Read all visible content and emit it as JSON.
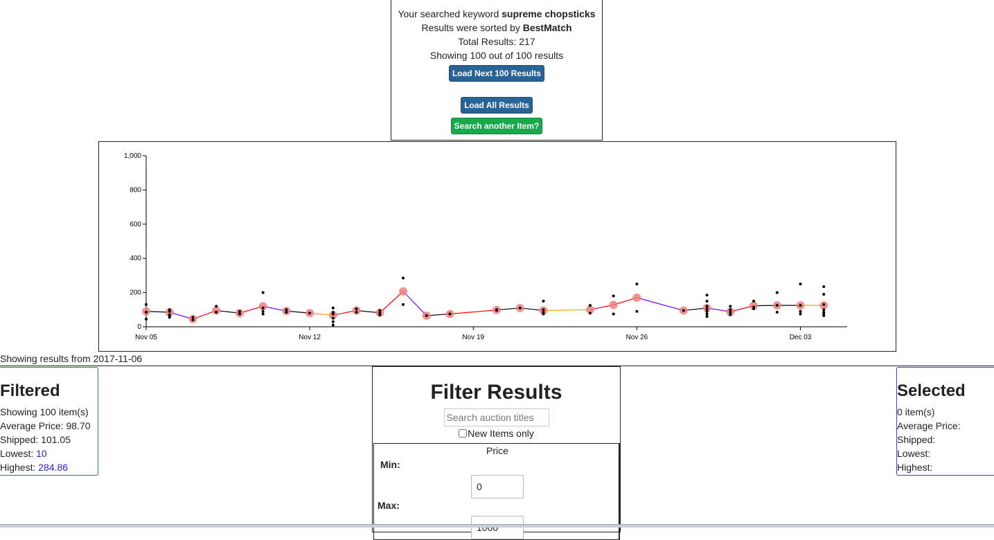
{
  "summary": {
    "keyword_prefix": "Your searched keyword",
    "keyword": "supreme chopsticks",
    "sorted_prefix": "Results were sorted by",
    "sorted_by": "BestMatch",
    "total_results": "Total Results: 217",
    "showing": "Showing 100 out of 100 results",
    "load_next_label": "Load Next 100 Results",
    "load_all_label": "Load All Results",
    "search_another_label": "Search another Item?"
  },
  "colors": {
    "button_blue": "#2a6496",
    "button_green": "#17a94a",
    "trend_up": "#ff0000",
    "trend_down": "#7a00ff",
    "trend_flat": "#ffa500",
    "trend_default": "#000000",
    "average_marker": "#f08080",
    "filtered_border": "#2c8a2c",
    "selected_border": "#5533cc"
  },
  "chart_data": {
    "type": "scatter",
    "title": "",
    "xlabel": "",
    "ylabel": "",
    "x_ticks": [
      "Nov 05",
      "Nov 12",
      "Nov 19",
      "Nov 26",
      "Dec 03"
    ],
    "y_ticks": [
      "0",
      "200",
      "400",
      "600",
      "800",
      "1,000"
    ],
    "ylim": [
      0,
      1000
    ],
    "xlim": [
      "2017-11-05",
      "2017-12-05"
    ],
    "series": [
      {
        "points": [
          [
            "2017-11-05",
            130
          ],
          [
            "2017-11-05",
            45
          ],
          [
            "2017-11-05",
            85
          ],
          [
            "2017-11-06",
            100
          ],
          [
            "2017-11-06",
            90
          ],
          [
            "2017-11-06",
            70
          ],
          [
            "2017-11-06",
            65
          ],
          [
            "2017-11-06",
            55
          ],
          [
            "2017-11-07",
            55
          ],
          [
            "2017-11-07",
            40
          ],
          [
            "2017-11-08",
            120
          ],
          [
            "2017-11-08",
            85
          ],
          [
            "2017-11-09",
            90
          ],
          [
            "2017-11-09",
            75
          ],
          [
            "2017-11-10",
            200
          ],
          [
            "2017-11-10",
            110
          ],
          [
            "2017-11-10",
            90
          ],
          [
            "2017-11-10",
            75
          ],
          [
            "2017-11-11",
            100
          ],
          [
            "2017-11-11",
            85
          ],
          [
            "2017-11-12",
            80
          ],
          [
            "2017-11-13",
            110
          ],
          [
            "2017-11-13",
            85
          ],
          [
            "2017-11-13",
            75
          ],
          [
            "2017-11-13",
            50
          ],
          [
            "2017-11-13",
            30
          ],
          [
            "2017-11-13",
            10
          ],
          [
            "2017-11-14",
            105
          ],
          [
            "2017-11-14",
            85
          ],
          [
            "2017-11-15",
            95
          ],
          [
            "2017-11-15",
            80
          ],
          [
            "2017-11-15",
            70
          ],
          [
            "2017-11-16",
            285
          ],
          [
            "2017-11-16",
            130
          ],
          [
            "2017-11-17",
            65
          ],
          [
            "2017-11-18",
            75
          ],
          [
            "2017-11-20",
            100
          ],
          [
            "2017-11-20",
            95
          ],
          [
            "2017-11-21",
            110
          ],
          [
            "2017-11-22",
            150
          ],
          [
            "2017-11-22",
            100
          ],
          [
            "2017-11-22",
            85
          ],
          [
            "2017-11-22",
            75
          ],
          [
            "2017-11-24",
            125
          ],
          [
            "2017-11-24",
            80
          ],
          [
            "2017-11-25",
            180
          ],
          [
            "2017-11-25",
            75
          ],
          [
            "2017-11-26",
            250
          ],
          [
            "2017-11-26",
            90
          ],
          [
            "2017-11-28",
            95
          ],
          [
            "2017-11-29",
            185
          ],
          [
            "2017-11-29",
            150
          ],
          [
            "2017-11-29",
            120
          ],
          [
            "2017-11-29",
            105
          ],
          [
            "2017-11-29",
            90
          ],
          [
            "2017-11-29",
            75
          ],
          [
            "2017-11-29",
            60
          ],
          [
            "2017-11-30",
            120
          ],
          [
            "2017-11-30",
            100
          ],
          [
            "2017-11-30",
            85
          ],
          [
            "2017-11-30",
            70
          ],
          [
            "2017-12-01",
            150
          ],
          [
            "2017-12-01",
            115
          ],
          [
            "2017-12-01",
            105
          ],
          [
            "2017-12-02",
            200
          ],
          [
            "2017-12-02",
            125
          ],
          [
            "2017-12-02",
            85
          ],
          [
            "2017-12-03",
            250
          ],
          [
            "2017-12-03",
            125
          ],
          [
            "2017-12-03",
            90
          ],
          [
            "2017-12-03",
            75
          ],
          [
            "2017-12-04",
            235
          ],
          [
            "2017-12-04",
            190
          ],
          [
            "2017-12-04",
            130
          ],
          [
            "2017-12-04",
            100
          ],
          [
            "2017-12-04",
            85
          ],
          [
            "2017-12-04",
            75
          ],
          [
            "2017-12-04",
            65
          ]
        ]
      },
      {
        "averages": [
          [
            "2017-11-05",
            90
          ],
          [
            "2017-11-06",
            85
          ],
          [
            "2017-11-07",
            45
          ],
          [
            "2017-11-08",
            95
          ],
          [
            "2017-11-09",
            80
          ],
          [
            "2017-11-10",
            120
          ],
          [
            "2017-11-11",
            92
          ],
          [
            "2017-11-12",
            80
          ],
          [
            "2017-11-13",
            68
          ],
          [
            "2017-11-14",
            95
          ],
          [
            "2017-11-15",
            82
          ],
          [
            "2017-11-16",
            207
          ],
          [
            "2017-11-17",
            65
          ],
          [
            "2017-11-18",
            75
          ],
          [
            "2017-11-20",
            98
          ],
          [
            "2017-11-21",
            110
          ],
          [
            "2017-11-22",
            95
          ],
          [
            "2017-11-24",
            100
          ],
          [
            "2017-11-25",
            128
          ],
          [
            "2017-11-26",
            170
          ],
          [
            "2017-11-28",
            95
          ],
          [
            "2017-11-29",
            110
          ],
          [
            "2017-11-30",
            88
          ],
          [
            "2017-12-01",
            123
          ],
          [
            "2017-12-02",
            125
          ],
          [
            "2017-12-03",
            125
          ],
          [
            "2017-12-04",
            125
          ]
        ]
      }
    ],
    "grid": false
  },
  "range_text": "Showing results from 2017-11-06",
  "filtered": {
    "title": "Filtered",
    "count": "Showing 100 item(s)",
    "avg_label": "Average Price:",
    "avg_value": "98.70",
    "shipped_label": "Shipped:",
    "shipped_value": "101.05",
    "lowest_label": "Lowest:",
    "lowest_value": "10",
    "highest_label": "Highest:",
    "highest_value": "284.86"
  },
  "selected": {
    "title": "Selected",
    "count": "0 item(s)",
    "avg_label": "Average Price:",
    "shipped_label": "Shipped:",
    "lowest_label": "Lowest:",
    "highest_label": "Highest:"
  },
  "filter": {
    "title": "Filter Results",
    "search_placeholder": "Search auction titles",
    "search_value": "",
    "new_only_label": "New Items only",
    "price_title": "Price",
    "min_label": "Min:",
    "min_value": "0",
    "max_label": "Max:",
    "max_value": "1000"
  }
}
